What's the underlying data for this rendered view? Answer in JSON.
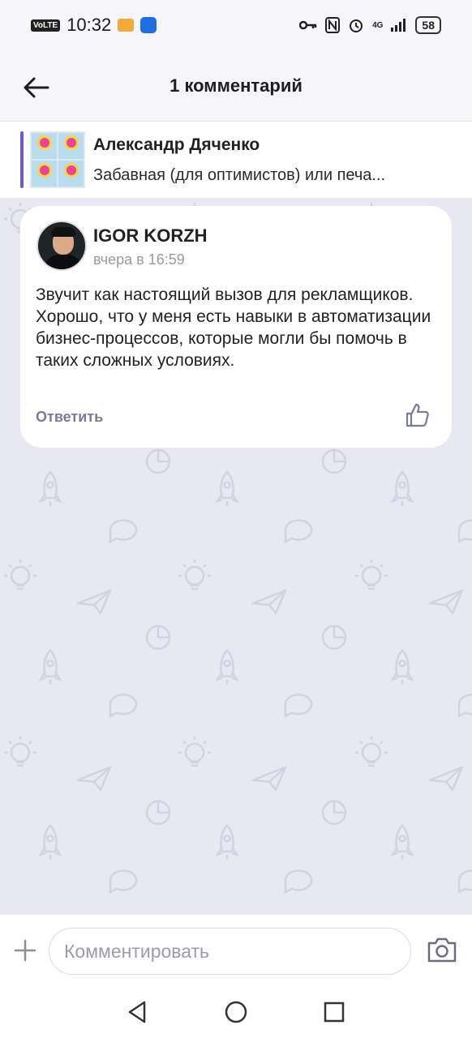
{
  "status_bar": {
    "network_badge": "VoLTE",
    "time": "10:32",
    "signal": "4G",
    "battery": "58"
  },
  "header": {
    "title": "1 комментарий",
    "back_icon": "arrow-left-icon"
  },
  "quoted_post": {
    "author": "Александр Дяченко",
    "snippet": "Забавная (для оптимистов) или печа..."
  },
  "comment": {
    "author": "IGOR KORZH",
    "time": "вчера в 16:59",
    "text": "Звучит как настоящий вызов для рекламщиков. Хорошо, что у меня есть навыки в автоматизации бизнес-процессов, которые могли бы помочь в таких сложных условиях.",
    "reply_label": "Ответить",
    "like_icon": "thumbs-up-icon"
  },
  "composer": {
    "placeholder": "Комментировать",
    "plus_icon": "plus-icon",
    "camera_icon": "camera-icon"
  },
  "colors": {
    "accent": "#6a5ad8",
    "feed_background": "#e8e8f2",
    "muted_text": "#9a9aa2"
  }
}
